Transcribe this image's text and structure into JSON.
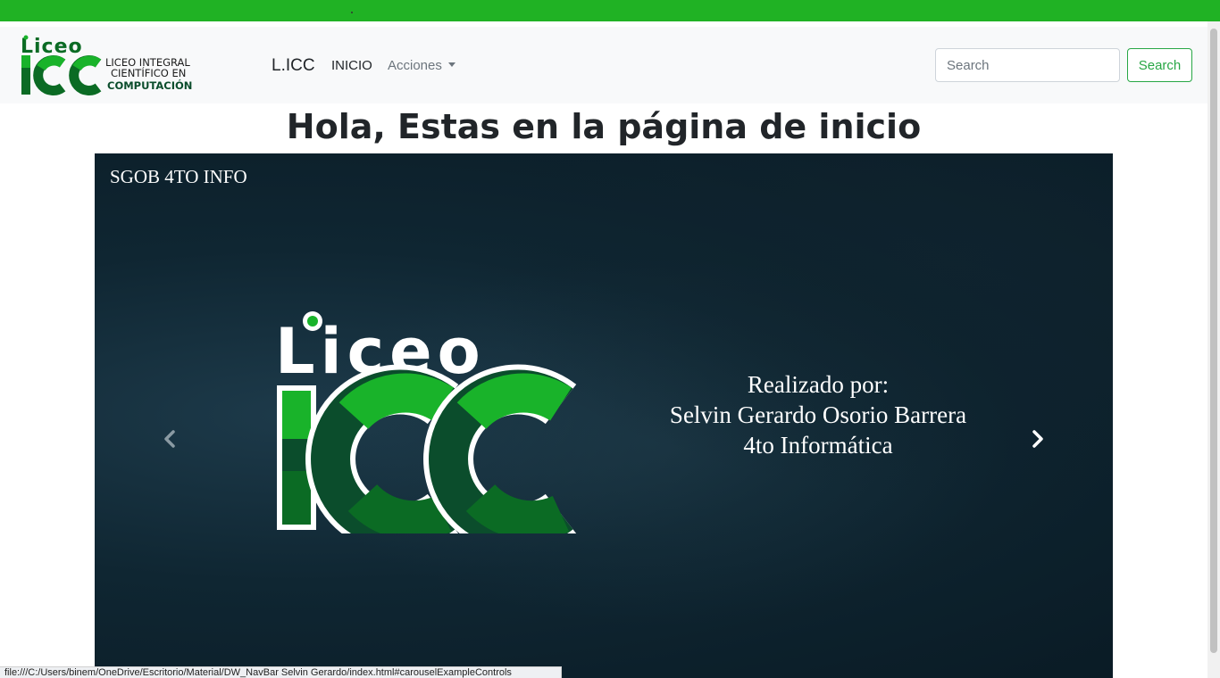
{
  "navbar": {
    "logo_text": [
      "Liceo",
      "ICC",
      "LICEO INTEGRAL",
      "CIENTÍFICO EN",
      "COMPUTACIÓN"
    ],
    "brand": "L.ICC",
    "items": [
      {
        "label": "INICIO"
      },
      {
        "label": "Acciones"
      }
    ],
    "search": {
      "placeholder": "Search",
      "value": "",
      "button_label": "Search"
    }
  },
  "main": {
    "heading": "Hola, Estas en la página de inicio"
  },
  "carousel": {
    "tag": "SGOB 4TO INFO",
    "logo_text": [
      "Liceo",
      "ICC"
    ],
    "credit_lines": [
      "Realizado por:",
      "Selvin Gerardo Osorio Barrera",
      "4to Informática"
    ],
    "controls": {
      "prev": "previous-icon",
      "next": "next-icon"
    }
  },
  "status_bar": {
    "url": "file:///C:/Users/binem/OneDrive/Escritorio/Material/DW_NavBar Selvin Gerardo/index.html#carouselExampleControls"
  },
  "colors": {
    "top_bar": "#20b224",
    "navbar_bg": "#f8f9fa",
    "brand_green": "#0a9b1a",
    "dark_green": "#0b4d2c",
    "success": "#28a745",
    "carousel_bg": "#0f2632"
  }
}
